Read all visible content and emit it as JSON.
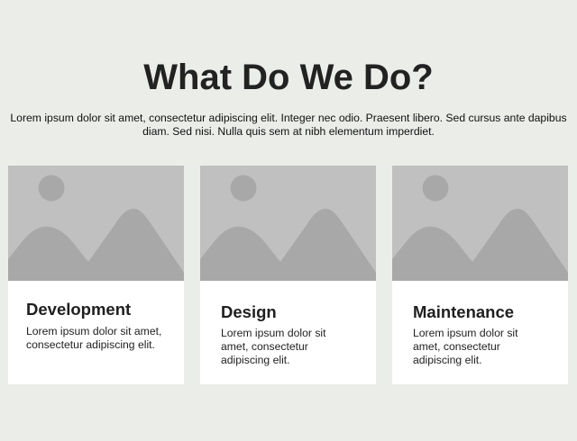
{
  "header": {
    "title": "What Do We Do?",
    "intro": "Lorem ipsum dolor sit amet, consectetur adipiscing elit. Integer nec odio. Praesent libero. Sed cursus ante dapibus\ndiam. Sed nisi. Nulla quis sem at nibh elementum imperdiet."
  },
  "cards": [
    {
      "title": "Development",
      "text": "Lorem ipsum dolor sit amet, consectetur adipiscing elit.",
      "image_icon": "image-placeholder-icon"
    },
    {
      "title": "Design",
      "text": "Lorem ipsum dolor sit amet, consectetur adipiscing elit.",
      "image_icon": "image-placeholder-icon"
    },
    {
      "title": "Maintenance",
      "text": "Lorem ipsum dolor sit amet, consectetur adipiscing elit.",
      "image_icon": "image-placeholder-icon"
    }
  ],
  "colors": {
    "background": "#ebede9",
    "card": "#ffffff",
    "placeholder_sky": "#c0c0c0",
    "placeholder_shapes": "#a8a8a8"
  }
}
